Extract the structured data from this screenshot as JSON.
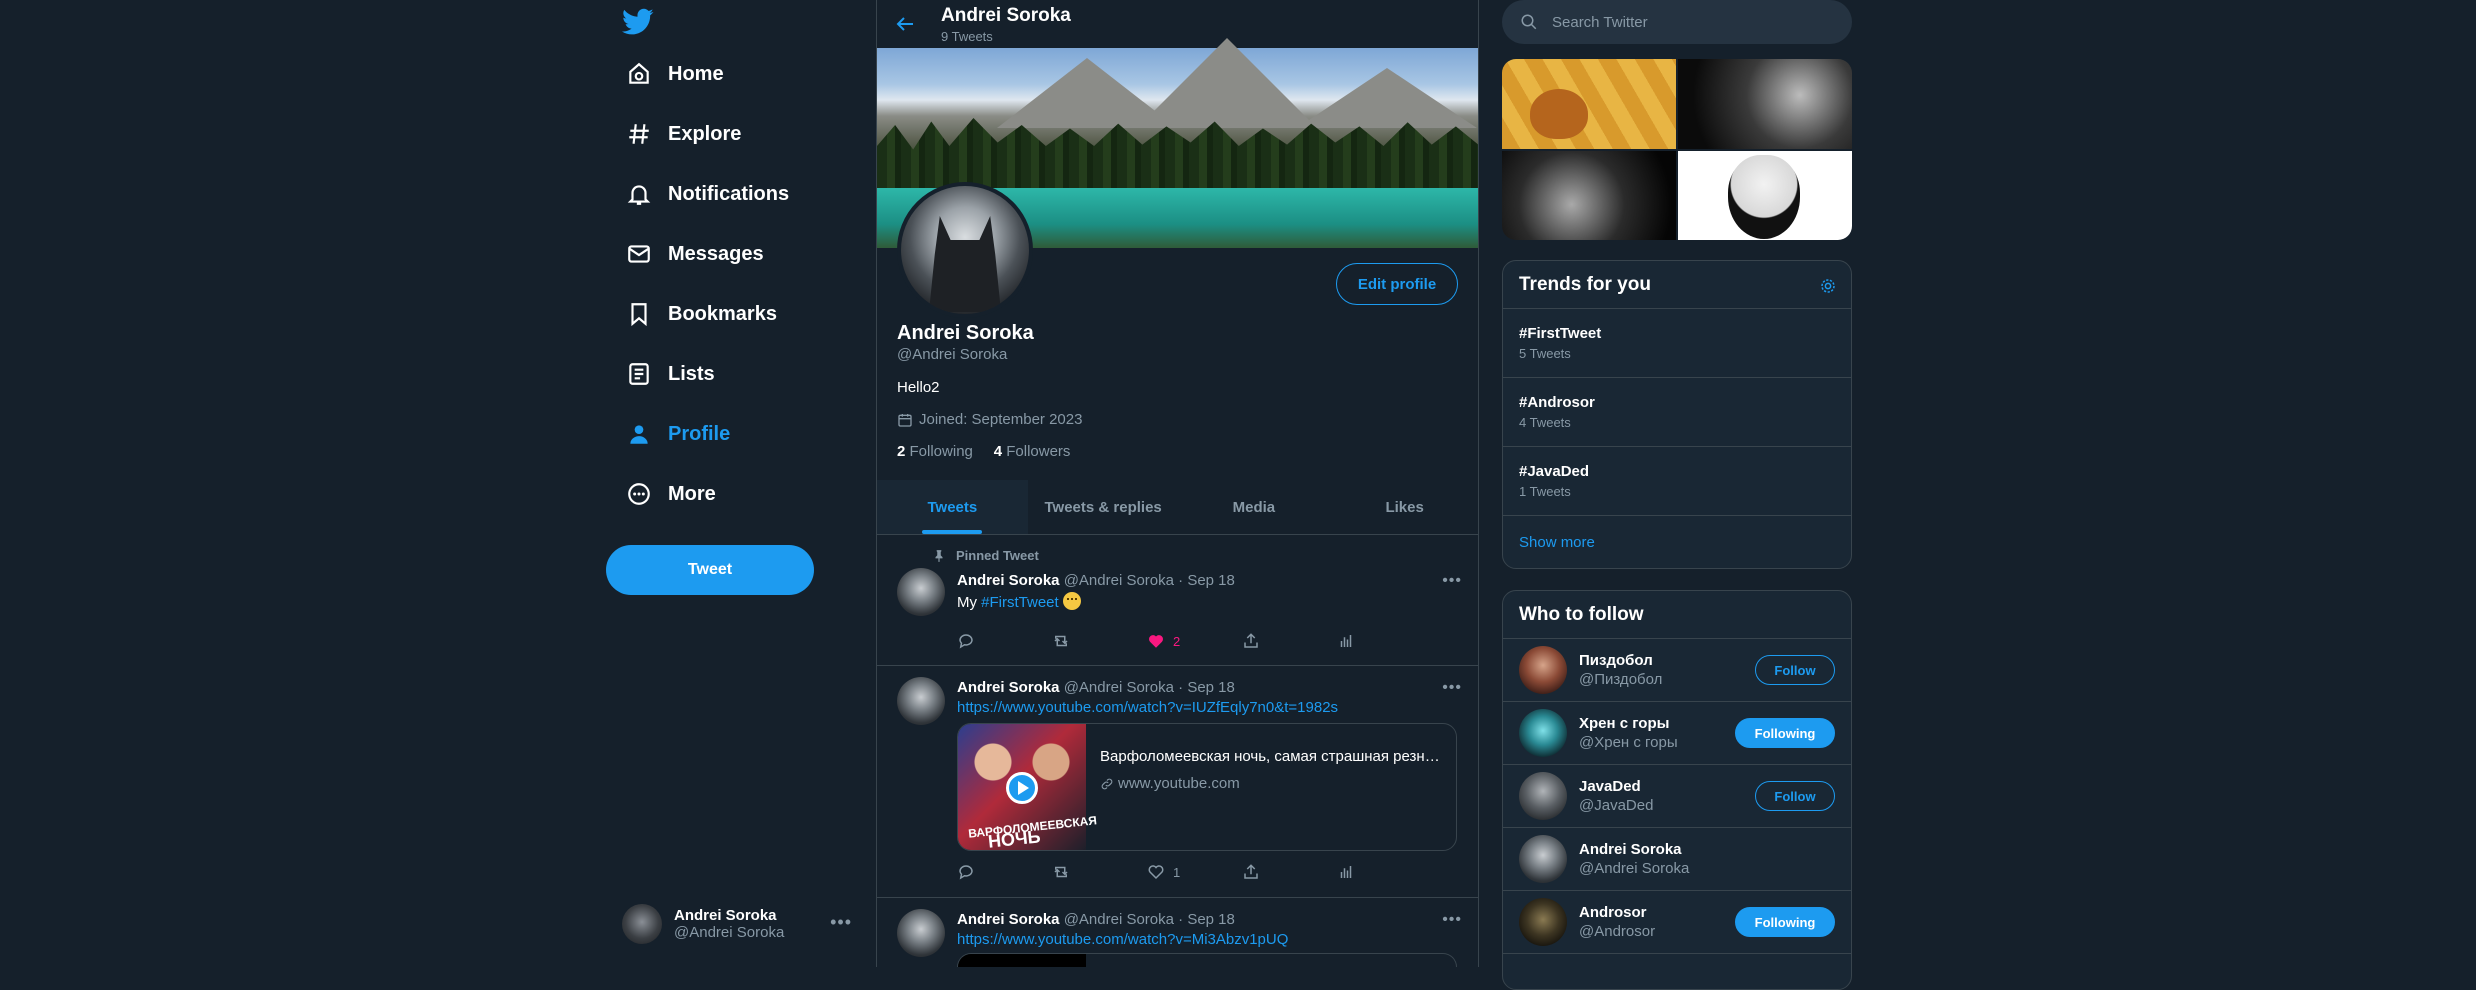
{
  "nav": {
    "items": [
      {
        "label": "Home",
        "icon": "home-icon"
      },
      {
        "label": "Explore",
        "icon": "hashtag-icon"
      },
      {
        "label": "Notifications",
        "icon": "bell-icon"
      },
      {
        "label": "Messages",
        "icon": "envelope-icon"
      },
      {
        "label": "Bookmarks",
        "icon": "bookmark-icon"
      },
      {
        "label": "Lists",
        "icon": "list-icon"
      },
      {
        "label": "Profile",
        "icon": "person-icon",
        "active": true
      },
      {
        "label": "More",
        "icon": "more-circle-icon"
      }
    ],
    "tweet_button": "Tweet",
    "account": {
      "name": "Andrei Soroka",
      "handle": "@Andrei Soroka"
    }
  },
  "header": {
    "name": "Andrei Soroka",
    "tweet_count": "9 Tweets"
  },
  "profile": {
    "edit_button": "Edit profile",
    "name": "Andrei Soroka",
    "handle": "@Andrei Soroka",
    "bio": "Hello2",
    "joined": "Joined: September 2023",
    "following_count": "2",
    "following_label": "Following",
    "followers_count": "4",
    "followers_label": "Followers"
  },
  "tabs": [
    "Tweets",
    "Tweets & replies",
    "Media",
    "Likes"
  ],
  "tweets": [
    {
      "pinned_label": "Pinned Tweet",
      "name": "Andrei Soroka",
      "meta": "@Andrei Soroka · Sep 18",
      "text_prefix": "My ",
      "hashtag": "#FirstTweet",
      "like_count": "2"
    },
    {
      "name": "Andrei Soroka",
      "meta": "@Andrei Soroka · Sep 18",
      "link": "https://www.youtube.com/watch?v=IUZfEqly7n0&t=1982s",
      "card_title": "Варфоломеевская ночь, самая страшная резня ...",
      "card_domain": "www.youtube.com",
      "card_caption_1": "ВАРФОЛОМЕЕВСКАЯ",
      "card_caption_2": "НОЧЬ",
      "like_count": "1"
    },
    {
      "name": "Andrei Soroka",
      "meta": "@Andrei Soroka · Sep 18",
      "link": "https://www.youtube.com/watch?v=Mi3Abzv1pUQ"
    }
  ],
  "search": {
    "placeholder": "Search Twitter"
  },
  "trends": {
    "title": "Trends for you",
    "items": [
      {
        "name": "#FirstTweet",
        "count": "5 Tweets"
      },
      {
        "name": "#Androsor",
        "count": "4 Tweets"
      },
      {
        "name": "#JavaDed",
        "count": "1 Tweets"
      }
    ],
    "show_more": "Show more"
  },
  "who_to_follow": {
    "title": "Who to follow",
    "items": [
      {
        "name": "Пиздобол",
        "handle": "@Пиздобол",
        "button": "Follow"
      },
      {
        "name": "Хрен с горы",
        "handle": "@Хрен с горы",
        "button": "Following"
      },
      {
        "name": "JavaDed",
        "handle": "@JavaDed",
        "button": "Follow"
      },
      {
        "name": "Andrei Soroka",
        "handle": "@Andrei Soroka"
      },
      {
        "name": "Androsor",
        "handle": "@Androsor",
        "button": "Following"
      }
    ]
  },
  "colors": {
    "accent": "#1d9bf0",
    "background": "#15202b",
    "panel": "#192734",
    "like": "#f91880"
  }
}
